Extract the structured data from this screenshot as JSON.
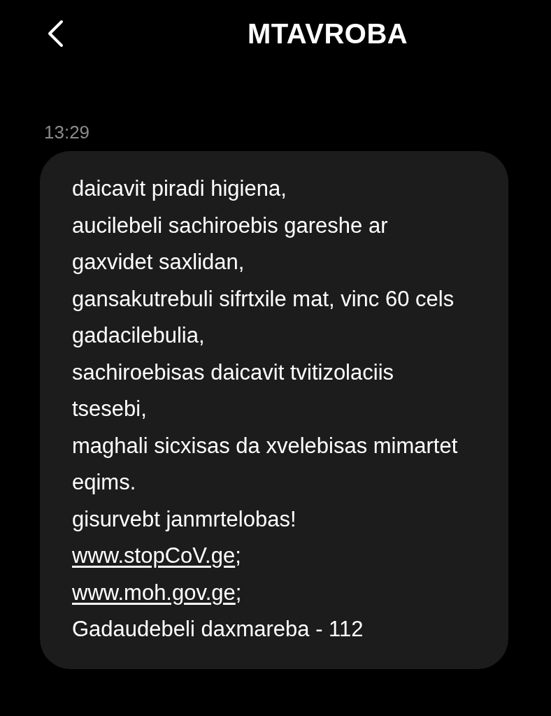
{
  "header": {
    "title": "MTAVROBA"
  },
  "message": {
    "time": "13:29",
    "lines": [
      {
        "kind": "text",
        "text": "daicavit piradi higiena,"
      },
      {
        "kind": "text",
        "text": "aucilebeli sachiroebis gareshe ar gaxvidet saxlidan,"
      },
      {
        "kind": "text",
        "text": "gansakutrebuli sifrtxile mat, vinc 60 cels gadacilebulia,"
      },
      {
        "kind": "text",
        "text": "sachiroebisas daicavit tvitizolaciis tsesebi,"
      },
      {
        "kind": "text",
        "text": "maghali sicxisas da xvelebisas mimartet eqims."
      },
      {
        "kind": "text",
        "text": "gisurvebt janmrtelobas!"
      },
      {
        "kind": "link",
        "text": "www.stopCoV.ge",
        "suffix": ";"
      },
      {
        "kind": "link",
        "text": "www.moh.gov.ge",
        "suffix": ";"
      },
      {
        "kind": "text",
        "text": "Gadaudebeli daxmareba - 112"
      }
    ]
  }
}
